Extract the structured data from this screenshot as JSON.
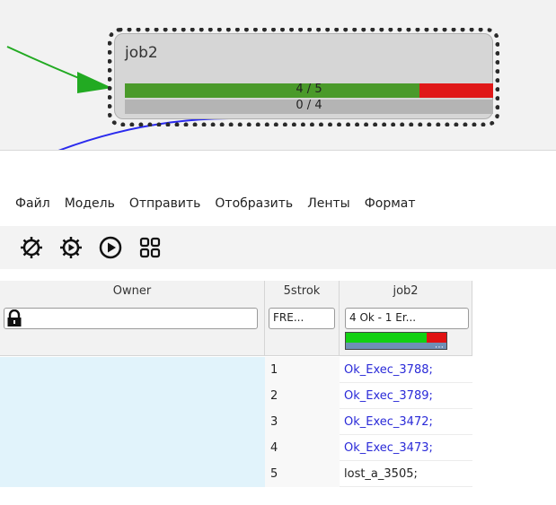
{
  "node": {
    "title": "job2",
    "progress_ok_label": "4 / 5",
    "progress_ok_fraction": 0.8,
    "progress_wait_label": "0 / 4",
    "colors": {
      "ok": "#4a9a2a",
      "error": "#e01818",
      "wait": "#b4b4b4"
    }
  },
  "edges": {
    "incoming_color": "#22aa22",
    "outgoing_color": "#2a2aee"
  },
  "menu": {
    "items": [
      "Файл",
      "Модель",
      "Отправить",
      "Отобразить",
      "Ленты",
      "Формат"
    ]
  },
  "toolbar": {
    "icons": [
      "gear-outline-icon",
      "gear-play-icon",
      "play-icon",
      "grid-icon"
    ]
  },
  "table": {
    "columns": [
      {
        "name": "Owner",
        "filter_icon": "lock-icon"
      },
      {
        "name": "5strok",
        "filter": "FRE..."
      },
      {
        "name": "job2",
        "filter": "4 Ok - 1 Er...",
        "ok_fraction": 0.8
      }
    ],
    "rows": [
      {
        "num": "1",
        "job": "Ok_Exec_3788;",
        "status": "ok"
      },
      {
        "num": "2",
        "job": "Ok_Exec_3789;",
        "status": "ok"
      },
      {
        "num": "3",
        "job": "Ok_Exec_3472;",
        "status": "ok"
      },
      {
        "num": "4",
        "job": "Ok_Exec_3473;",
        "status": "ok"
      },
      {
        "num": "5",
        "job": "lost_a_3505;",
        "status": "lost"
      }
    ]
  }
}
